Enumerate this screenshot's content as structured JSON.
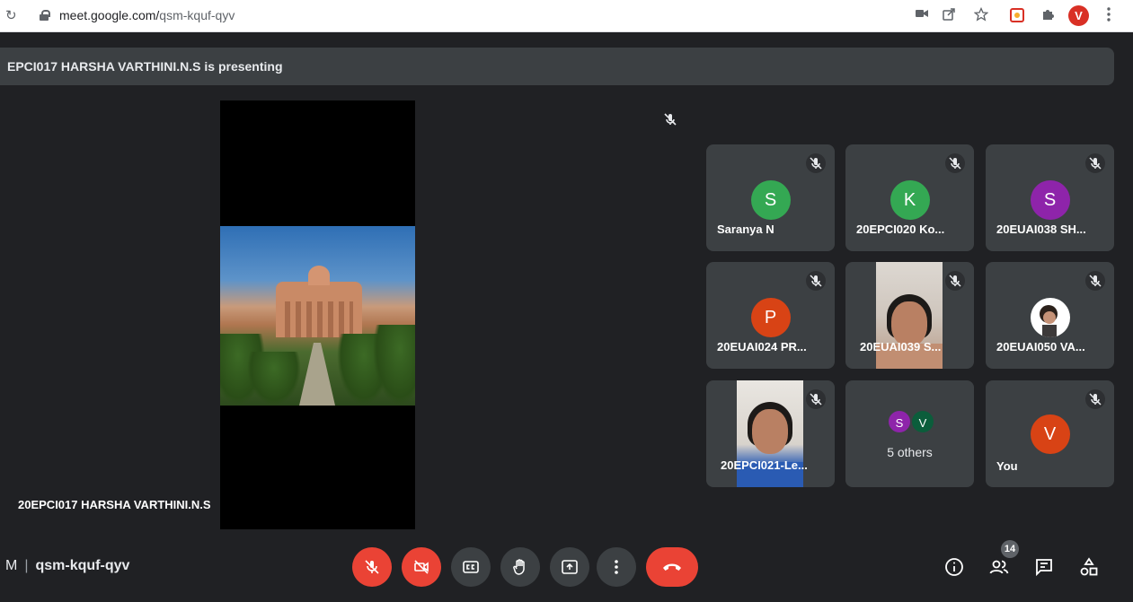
{
  "browser": {
    "url_host": "meet.google.com/",
    "url_path": "qsm-kquf-qyv",
    "reload_glyph": "↻",
    "profile_initial": "V",
    "colors": {
      "profile": "#d93025"
    }
  },
  "presenting": {
    "banner_text": "EPCI017 HARSHA VARTHINI.N.S is presenting",
    "presenter_name": "20EPCI017 HARSHA VARTHINI.N.S"
  },
  "participants": [
    {
      "name": "Saranya N",
      "initial": "S",
      "color": "#34a853",
      "muted": true,
      "type": "avatar"
    },
    {
      "name": "20EPCI020 Ko...",
      "initial": "K",
      "color": "#34a853",
      "muted": true,
      "type": "avatar"
    },
    {
      "name": "20EUAI038 SH...",
      "initial": "S",
      "color": "#8e24aa",
      "muted": true,
      "type": "avatar"
    },
    {
      "name": "20EUAI024 PR...",
      "initial": "P",
      "color": "#d84315",
      "muted": true,
      "type": "avatar"
    },
    {
      "name": "20EUAI039 S...",
      "muted": true,
      "type": "video"
    },
    {
      "name": "20EUAI050 VA...",
      "muted": true,
      "type": "photo-avatar"
    },
    {
      "name": "20EPCI021-Le...",
      "muted": true,
      "type": "video"
    },
    {
      "name": "5 others",
      "type": "others",
      "mini_avatars": [
        {
          "initial": "S",
          "color": "#8e24aa"
        },
        {
          "initial": "V",
          "color": "#0b5d3b"
        }
      ]
    },
    {
      "name": "You",
      "initial": "V",
      "color": "#d84315",
      "muted": true,
      "type": "avatar"
    }
  ],
  "meeting": {
    "time_fragment": "M",
    "separator": "|",
    "code": "qsm-kquf-qyv"
  },
  "controls": [
    {
      "name": "microphone-off-button",
      "icon": "mic-off-icon",
      "state": "off"
    },
    {
      "name": "camera-off-button",
      "icon": "camera-off-icon",
      "state": "off"
    },
    {
      "name": "captions-button",
      "icon": "closed-captions-icon"
    },
    {
      "name": "raise-hand-button",
      "icon": "hand-icon"
    },
    {
      "name": "present-now-button",
      "icon": "present-icon"
    },
    {
      "name": "more-options-button",
      "icon": "more-vert-icon"
    },
    {
      "name": "leave-call-button",
      "icon": "call-end-icon"
    }
  ],
  "side_panel": {
    "people_count": "14",
    "icons": [
      "info-icon",
      "people-icon",
      "chat-icon",
      "activities-icon"
    ]
  },
  "colors": {
    "background": "#202124",
    "tile": "#3c4043",
    "danger": "#ea4335"
  }
}
